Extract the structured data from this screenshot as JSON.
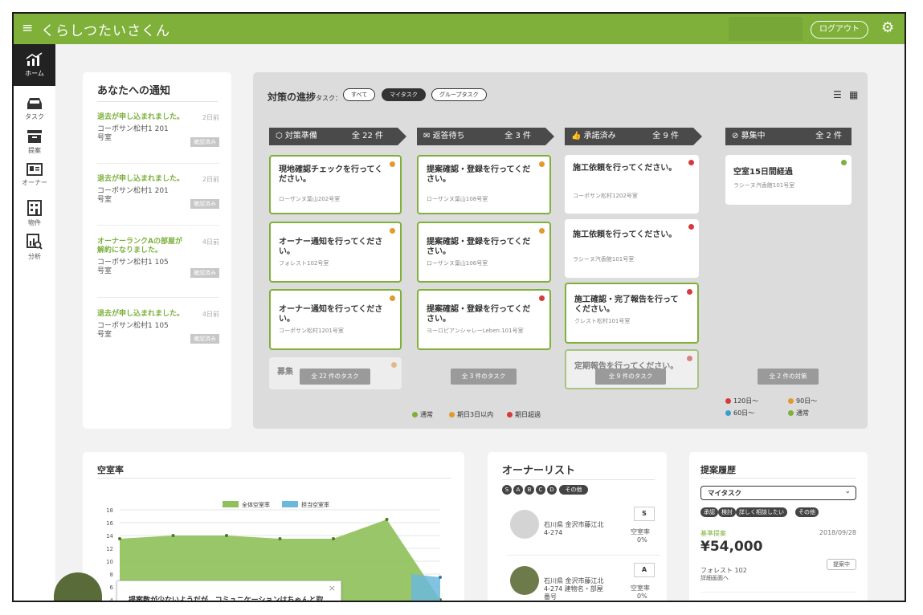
{
  "app": {
    "title": "くらしつたいさくん",
    "logout": "ログアウト"
  },
  "sidebar": {
    "items": [
      {
        "label": "ホーム",
        "icon": "home-chart-icon"
      },
      {
        "label": "タスク",
        "icon": "tray-icon"
      },
      {
        "label": "提案",
        "icon": "box-icon"
      },
      {
        "label": "オーナー",
        "icon": "id-card-icon"
      },
      {
        "label": "物件",
        "icon": "building-icon"
      },
      {
        "label": "分析",
        "icon": "analysis-icon"
      }
    ]
  },
  "notifications": {
    "title": "あなたへの通知",
    "items": [
      {
        "text": "退去が申し込まれました。",
        "ago": "2日前",
        "property": "コーポサン松村1 201号室",
        "status": "確認済み"
      },
      {
        "text": "退去が申し込まれました。",
        "ago": "2日前",
        "property": "コーポサン松村1 201号室",
        "status": "確認済み"
      },
      {
        "text": "オーナーランクAの部屋が解約になりました。",
        "ago": "4日前",
        "property": "コーポサン松村1 105号室",
        "status": "確認済み"
      },
      {
        "text": "退去が申し込まれました。",
        "ago": "4日前",
        "property": "コーポサン松村1 105号室",
        "status": "確認済み"
      }
    ]
  },
  "progress": {
    "title": "対策の進捗",
    "title_small": "タスク：",
    "filters": [
      "すべて",
      "マイタスク",
      "グループタスク"
    ],
    "columns": [
      {
        "title": "対策準備",
        "count": "全 22 件",
        "more": "全 22 件のタスク",
        "cards": [
          {
            "title": "現地確認チェックを行ってください。",
            "sub": "ローザンヌ葉山202号室",
            "dot": "o"
          },
          {
            "title": "オーナー通知を行ってください。",
            "sub": "フォレスト102号室",
            "dot": "o"
          },
          {
            "title": "オーナー通知を行ってください。",
            "sub": "コーポサン松村1201号室",
            "dot": "o"
          },
          {
            "title": "募集",
            "sub": "",
            "dot": "o"
          }
        ]
      },
      {
        "title": "返答待ち",
        "count": "全 3 件",
        "more": "全 3 件のタスク",
        "cards": [
          {
            "title": "提案確認・登録を行ってください。",
            "sub": "ローザンヌ葉山108号室",
            "dot": "o"
          },
          {
            "title": "提案確認・登録を行ってください。",
            "sub": "ローザンヌ葉山106号室",
            "dot": "o"
          },
          {
            "title": "提案確認・登録を行ってください。",
            "sub": "ヨーロピアンシャレーLeben.101号室",
            "dot": "r"
          }
        ]
      },
      {
        "title": "承諾済み",
        "count": "全 9 件",
        "more": "全 9 件のタスク",
        "cards": [
          {
            "title": "施工依頼を行ってください。",
            "sub": "コーポサン松村1202号室",
            "dot": "r"
          },
          {
            "title": "施工依頼を行ってください。",
            "sub": "ラシーヌ汽香館101号室",
            "dot": "r"
          },
          {
            "title": "施工確認・完了報告を行ってください。",
            "sub": "クレスト松村101号室",
            "dot": "r"
          },
          {
            "title": "定期報告を行ってください。",
            "sub": "",
            "dot": "r"
          }
        ]
      },
      {
        "title": "募集中",
        "count": "全 2 件",
        "more": "全 2 件の対策",
        "cards": [
          {
            "title": "空室15日間経過",
            "sub": "ラシーヌ汽香館101号室",
            "dot": "g"
          }
        ]
      }
    ],
    "legend": [
      {
        "label": "通常",
        "color": "#7fb03a"
      },
      {
        "label": "期日3日以内",
        "color": "#e39a2d"
      },
      {
        "label": "期日超過",
        "color": "#d63b3b"
      }
    ],
    "legend2": [
      {
        "label": "120日〜",
        "color": "#d63b3b"
      },
      {
        "label": "90日〜",
        "color": "#e39a2d"
      },
      {
        "label": "60日〜",
        "color": "#3c9dd0"
      },
      {
        "label": "通常",
        "color": "#7fb03a"
      }
    ]
  },
  "vacancy": {
    "title": "空室率",
    "popup": "提案数が少ないようだが、コミュニケーションはちゃんと取",
    "chart_data": {
      "type": "area",
      "series": [
        {
          "name": "全体空室率",
          "color": "#8fc05a",
          "values": [
            13.5,
            14,
            14,
            13.5,
            13.5,
            16.5,
            4
          ]
        },
        {
          "name": "担当空室率",
          "color": "#6bb8dc",
          "values": [
            null,
            null,
            null,
            null,
            null,
            null,
            7.5
          ]
        }
      ],
      "ylim": [
        0,
        18
      ],
      "yticks": [
        4,
        6,
        8,
        10,
        12,
        14,
        16,
        18
      ]
    }
  },
  "owners": {
    "title": "オーナーリスト",
    "filters": [
      "S",
      "A",
      "B",
      "C",
      "D",
      "その他"
    ],
    "items": [
      {
        "rank": "S",
        "address": "石川県 金沢市藤江北 4-274",
        "vacancy_label": "空室率",
        "vacancy_value": "0%"
      },
      {
        "rank": "A",
        "address": "石川県 金沢市藤江北 4-274 建物名・部屋番号",
        "vacancy_label": "空室率",
        "vacancy_value": "0%"
      }
    ]
  },
  "proposals": {
    "title": "提案履歴",
    "select_value": "マイタスク",
    "tags": [
      "承認",
      "検討",
      "詳しく相談したい",
      "その他"
    ],
    "item": {
      "type": "基準提案",
      "date": "2018/09/28",
      "amount": "¥54,000",
      "property": "フォレスト 102",
      "detail": "詳細画面へ",
      "status": "提案中"
    }
  }
}
